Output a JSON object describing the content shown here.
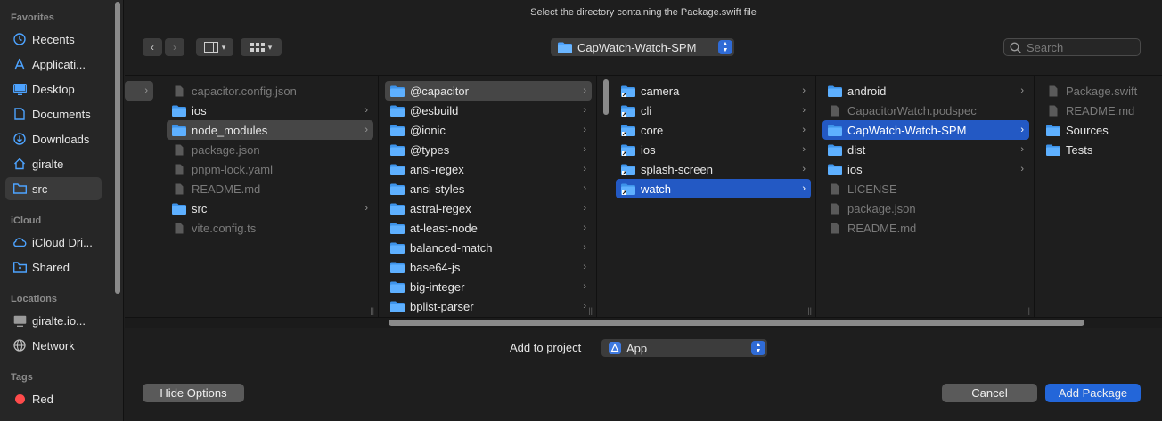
{
  "window": {
    "title": "Select the directory containing the Package.swift file"
  },
  "sidebar": {
    "favorites_label": "Favorites",
    "favorites": [
      {
        "label": "Recents",
        "icon": "clock-icon"
      },
      {
        "label": "Applicati...",
        "icon": "applications-icon"
      },
      {
        "label": "Desktop",
        "icon": "desktop-icon"
      },
      {
        "label": "Documents",
        "icon": "document-icon"
      },
      {
        "label": "Downloads",
        "icon": "download-icon"
      },
      {
        "label": "giralte",
        "icon": "home-icon"
      },
      {
        "label": "src",
        "icon": "folder-icon"
      }
    ],
    "icloud_label": "iCloud",
    "icloud": [
      {
        "label": "iCloud Dri...",
        "icon": "cloud-icon"
      },
      {
        "label": "Shared",
        "icon": "shared-folder-icon"
      }
    ],
    "locations_label": "Locations",
    "locations": [
      {
        "label": "giralte.io...",
        "icon": "computer-icon"
      },
      {
        "label": "Network",
        "icon": "globe-icon"
      }
    ],
    "tags_label": "Tags",
    "tags": [
      {
        "label": "Red",
        "color": "#ff4b4b"
      }
    ]
  },
  "toolbar": {
    "path": "CapWatch-Watch-SPM",
    "search_placeholder": "Search"
  },
  "columns": [
    {
      "items": [
        {
          "label": "capacitor.config.json",
          "kind": "file",
          "dim": true
        },
        {
          "label": "ios",
          "kind": "folder",
          "chevron": true
        },
        {
          "label": "node_modules",
          "kind": "folder",
          "chevron": true,
          "state": "hl"
        },
        {
          "label": "package.json",
          "kind": "file",
          "dim": true
        },
        {
          "label": "pnpm-lock.yaml",
          "kind": "file",
          "dim": true
        },
        {
          "label": "README.md",
          "kind": "file",
          "dim": true
        },
        {
          "label": "src",
          "kind": "folder",
          "chevron": true
        },
        {
          "label": "vite.config.ts",
          "kind": "file",
          "dim": true
        }
      ]
    },
    {
      "items": [
        {
          "label": "@capacitor",
          "kind": "folder",
          "chevron": true,
          "state": "hl"
        },
        {
          "label": "@esbuild",
          "kind": "folder",
          "chevron": true
        },
        {
          "label": "@ionic",
          "kind": "folder",
          "chevron": true
        },
        {
          "label": "@types",
          "kind": "folder",
          "chevron": true
        },
        {
          "label": "ansi-regex",
          "kind": "folder",
          "chevron": true
        },
        {
          "label": "ansi-styles",
          "kind": "folder",
          "chevron": true
        },
        {
          "label": "astral-regex",
          "kind": "folder",
          "chevron": true
        },
        {
          "label": "at-least-node",
          "kind": "folder",
          "chevron": true
        },
        {
          "label": "balanced-match",
          "kind": "folder",
          "chevron": true
        },
        {
          "label": "base64-js",
          "kind": "folder",
          "chevron": true
        },
        {
          "label": "big-integer",
          "kind": "folder",
          "chevron": true
        },
        {
          "label": "bplist-parser",
          "kind": "folder",
          "chevron": true
        }
      ]
    },
    {
      "items": [
        {
          "label": "camera",
          "kind": "alias",
          "chevron": true
        },
        {
          "label": "cli",
          "kind": "alias",
          "chevron": true
        },
        {
          "label": "core",
          "kind": "alias",
          "chevron": true
        },
        {
          "label": "ios",
          "kind": "alias",
          "chevron": true
        },
        {
          "label": "splash-screen",
          "kind": "alias",
          "chevron": true
        },
        {
          "label": "watch",
          "kind": "alias",
          "chevron": true,
          "state": "sel"
        }
      ]
    },
    {
      "items": [
        {
          "label": "android",
          "kind": "folder",
          "chevron": true
        },
        {
          "label": "CapacitorWatch.podspec",
          "kind": "file",
          "dim": true
        },
        {
          "label": "CapWatch-Watch-SPM",
          "kind": "folder",
          "chevron": true,
          "state": "sel"
        },
        {
          "label": "dist",
          "kind": "folder",
          "chevron": true
        },
        {
          "label": "ios",
          "kind": "folder",
          "chevron": true
        },
        {
          "label": "LICENSE",
          "kind": "file",
          "dim": true
        },
        {
          "label": "package.json",
          "kind": "file",
          "dim": true
        },
        {
          "label": "README.md",
          "kind": "file",
          "dim": true
        }
      ]
    },
    {
      "items": [
        {
          "label": "Package.swift",
          "kind": "file",
          "dim": true
        },
        {
          "label": "README.md",
          "kind": "file",
          "dim": true
        },
        {
          "label": "Sources",
          "kind": "folder"
        },
        {
          "label": "Tests",
          "kind": "folder"
        }
      ]
    }
  ],
  "footer": {
    "add_to_label": "Add to project",
    "project": "App",
    "hide_options": "Hide Options",
    "cancel": "Cancel",
    "add_package": "Add Package"
  },
  "colors": {
    "accent": "#2366d9",
    "selection": "#2359c4",
    "folder": "#4da3ff",
    "tag_red": "#ff4b4b"
  }
}
